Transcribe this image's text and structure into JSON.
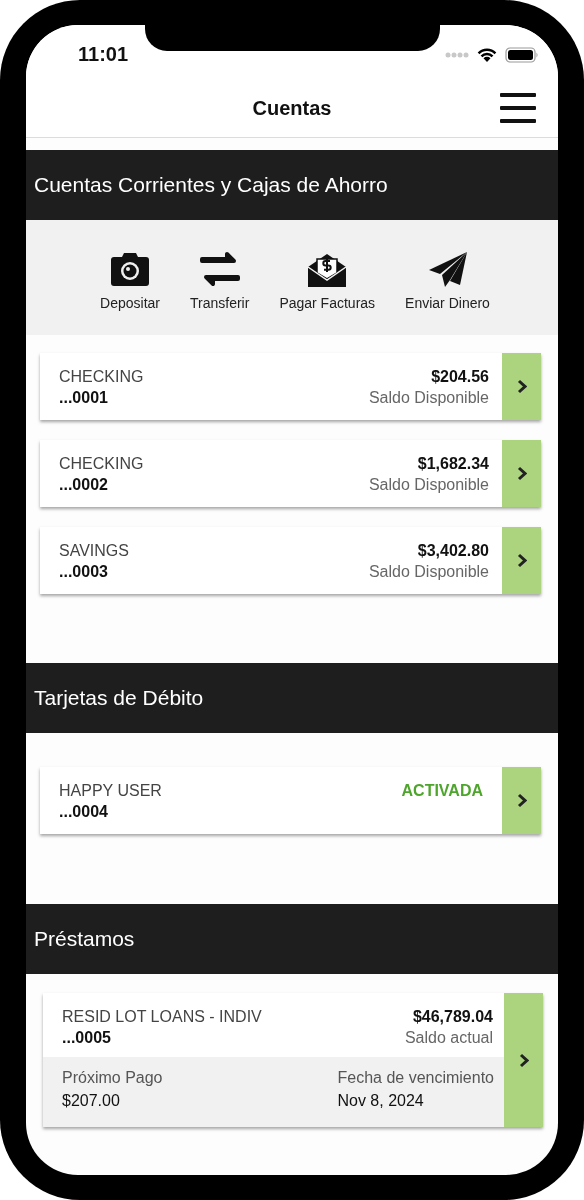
{
  "status_bar": {
    "time": "11:01"
  },
  "nav": {
    "title": "Cuentas"
  },
  "sections": [
    {
      "kind": "accounts",
      "title": "Cuentas Corrientes y Cajas de Ahorro",
      "actions": [
        {
          "label": "Depositar"
        },
        {
          "label": "Transferir"
        },
        {
          "label": "Pagar Facturas"
        },
        {
          "label": "Enviar Dinero"
        }
      ],
      "items": [
        {
          "type": "CHECKING",
          "number": "...0001",
          "amount": "$204.56",
          "caption": "Saldo Disponible"
        },
        {
          "type": "CHECKING",
          "number": "...0002",
          "amount": "$1,682.34",
          "caption": "Saldo Disponible"
        },
        {
          "type": "SAVINGS",
          "number": "...0003",
          "amount": "$3,402.80",
          "caption": "Saldo Disponible"
        }
      ]
    },
    {
      "kind": "cards",
      "title": "Tarjetas de Débito",
      "items": [
        {
          "name": "HAPPY USER",
          "number": "...0004",
          "status": "ACTIVADA"
        }
      ]
    },
    {
      "kind": "loans",
      "title": "Préstamos",
      "items": [
        {
          "type": "RESID LOT LOANS - INDIV",
          "number": "...0005",
          "amount": "$46,789.04",
          "caption": "Saldo actual",
          "details": [
            {
              "label": "Próximo Pago",
              "value": "$207.00"
            },
            {
              "label": "Fecha de vencimiento",
              "value": "Nov 8, 2024"
            }
          ]
        }
      ]
    }
  ]
}
